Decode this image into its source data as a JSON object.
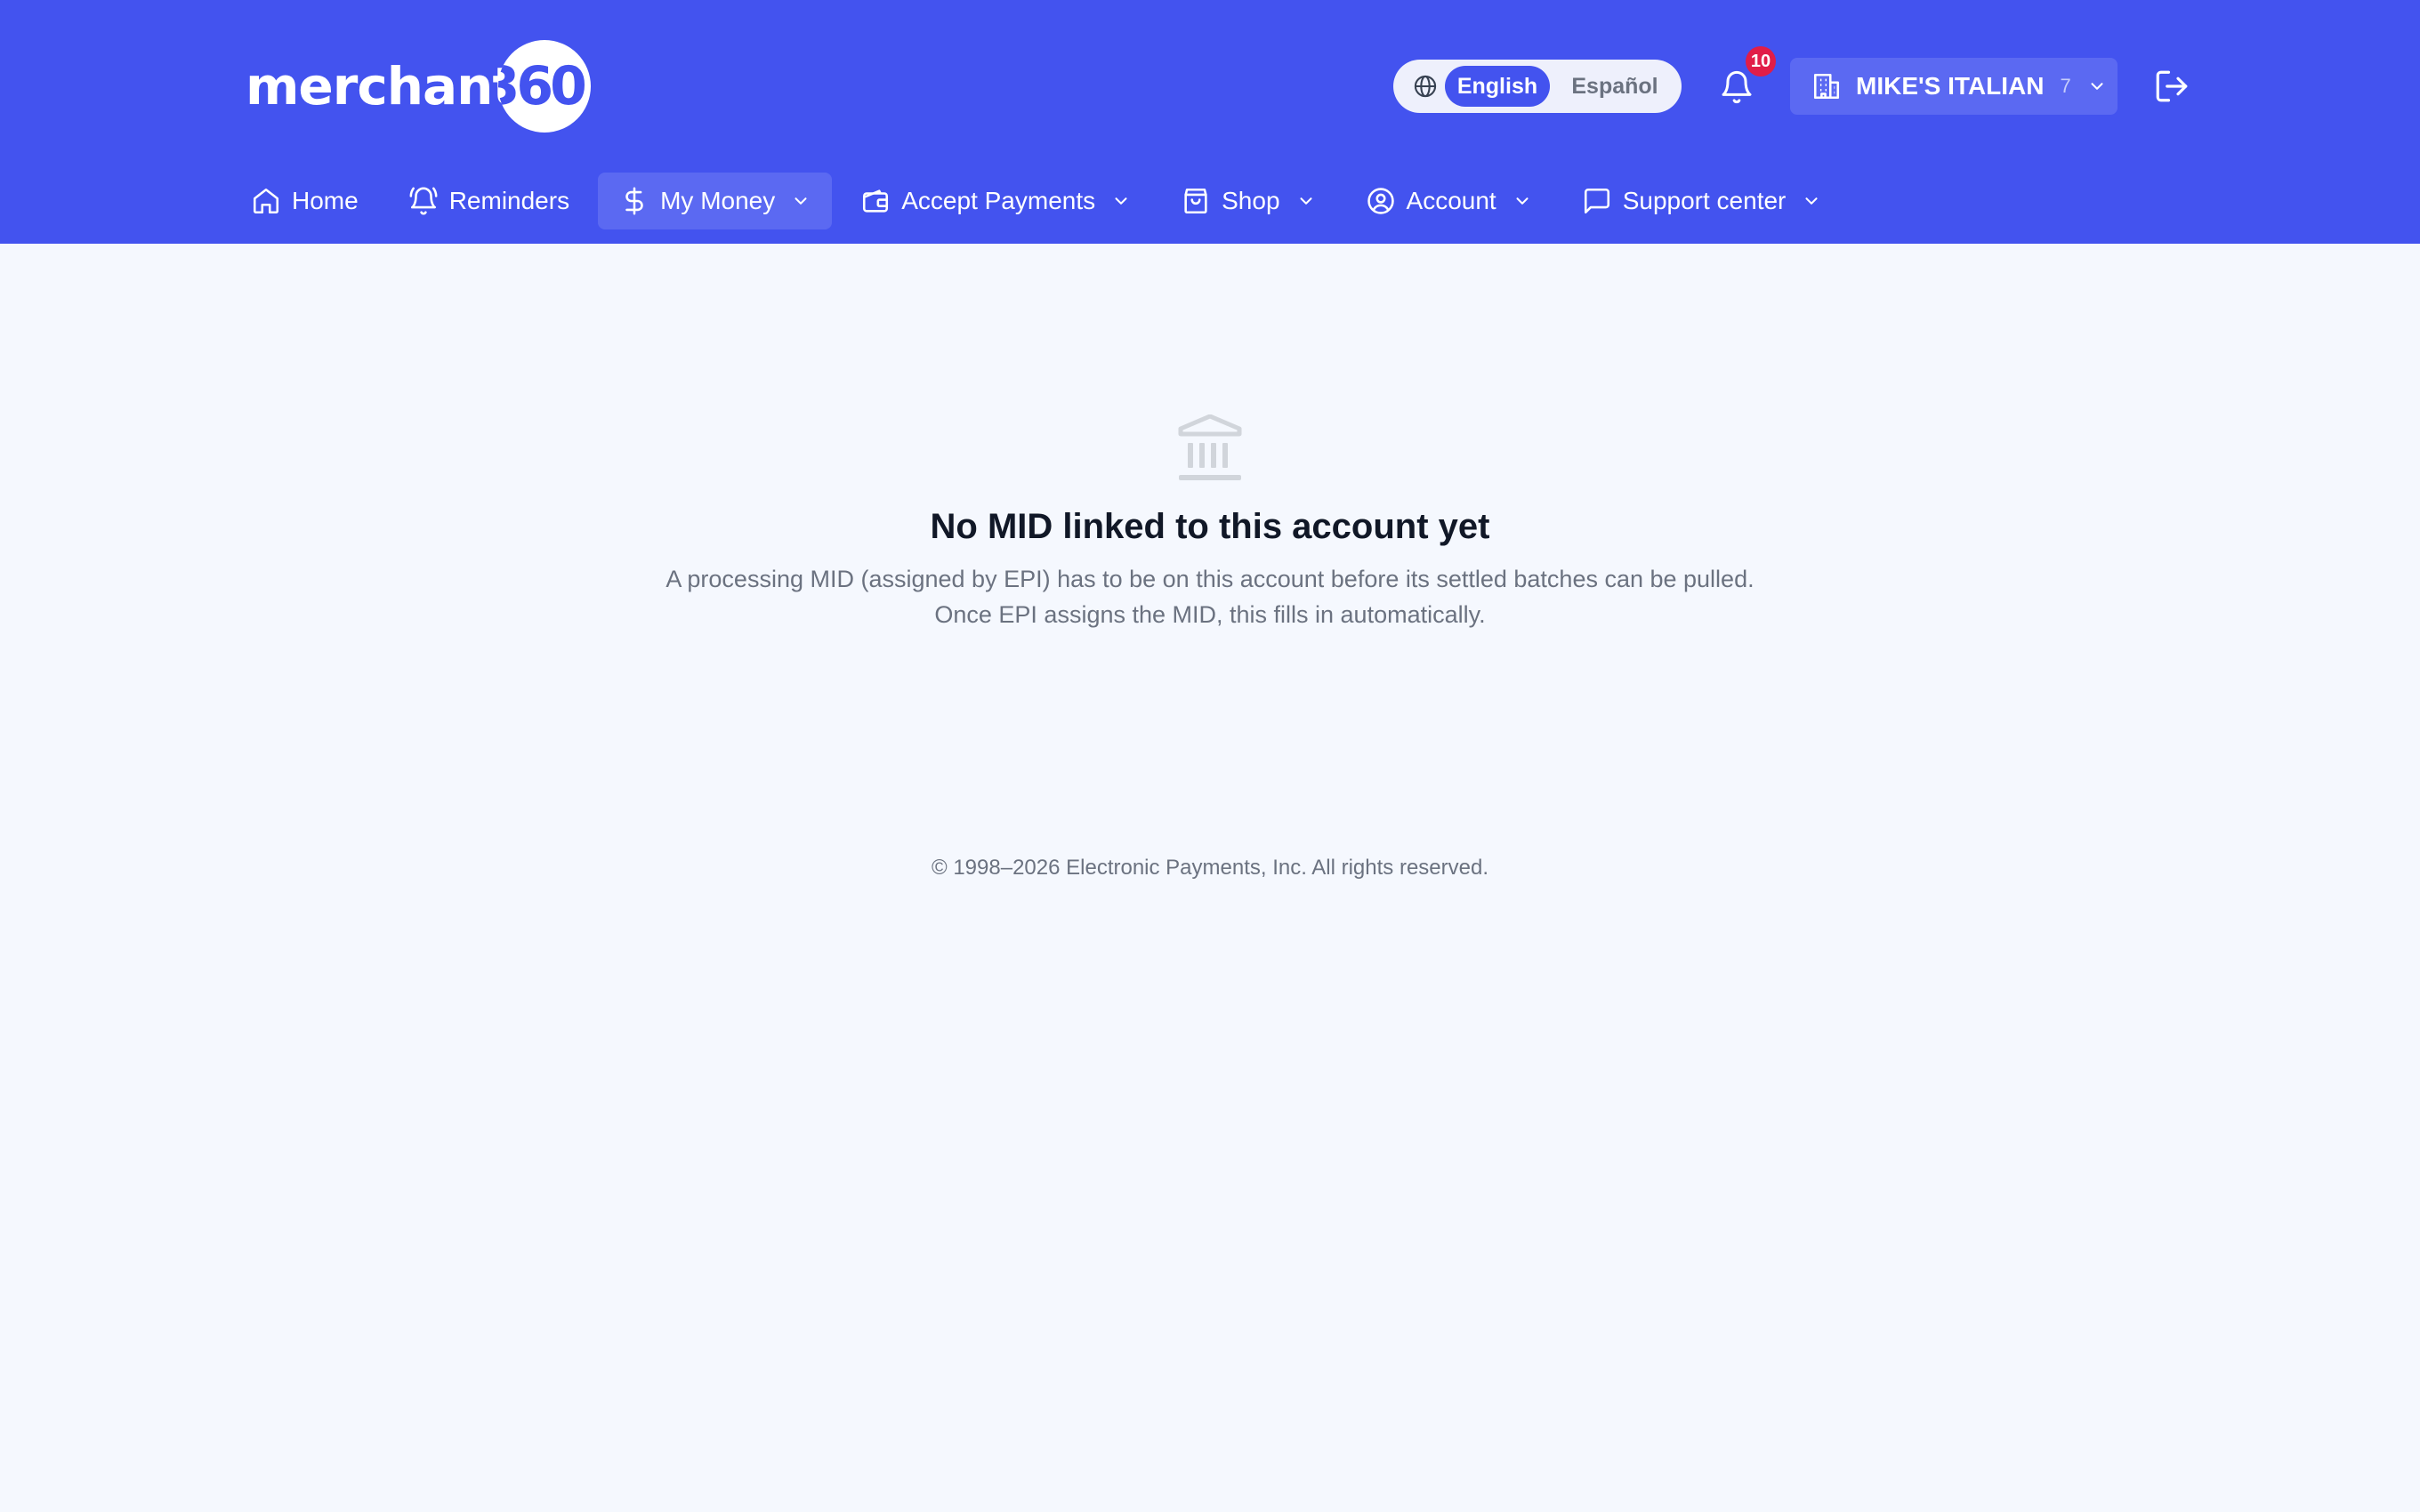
{
  "brand": {
    "logo_word": "merchant",
    "logo_number": "360",
    "primary_color": "#4353ef"
  },
  "language": {
    "icon": "globe-icon",
    "options": [
      "English",
      "Español"
    ],
    "selected": "English"
  },
  "notifications": {
    "icon": "bell-icon",
    "count": "10",
    "badge_color": "#e11d48"
  },
  "merchant": {
    "icon": "building-icon",
    "name": "MIKE'S ITALIAN",
    "count": "7"
  },
  "logout": {
    "icon": "logout-icon"
  },
  "nav": {
    "items": [
      {
        "label": "Home",
        "icon": "home-icon",
        "dropdown": false,
        "active": false
      },
      {
        "label": "Reminders",
        "icon": "bell-ring-icon",
        "dropdown": false,
        "active": false
      },
      {
        "label": "My Money",
        "icon": "dollar-icon",
        "dropdown": true,
        "active": true
      },
      {
        "label": "Accept Payments",
        "icon": "wallet-icon",
        "dropdown": true,
        "active": false
      },
      {
        "label": "Shop",
        "icon": "shopping-bag-icon",
        "dropdown": true,
        "active": false
      },
      {
        "label": "Account",
        "icon": "user-circle-icon",
        "dropdown": true,
        "active": false
      },
      {
        "label": "Support center",
        "icon": "message-square-icon",
        "dropdown": true,
        "active": false
      }
    ]
  },
  "empty_state": {
    "icon": "bank-icon",
    "title": "No MID linked to this account yet",
    "line1": "A processing MID (assigned by EPI) has to be on this account before its settled batches can be pulled.",
    "line2": "Once EPI assigns the MID, this fills in automatically."
  },
  "footer": {
    "copyright": "© 1998–2026 Electronic Payments, Inc. All rights reserved."
  }
}
